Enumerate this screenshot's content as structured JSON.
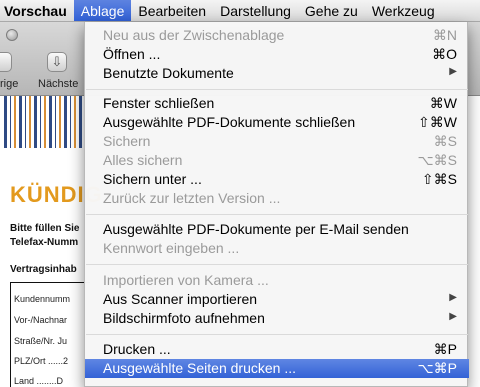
{
  "menubar": {
    "items": [
      "Vorschau",
      "Ablage",
      "Bearbeiten",
      "Darstellung",
      "Gehe zu",
      "Werkzeug"
    ]
  },
  "window": {
    "toolbar_prev_label": "rige",
    "toolbar_next_label": "Nächste"
  },
  "document": {
    "heading": "KÜNDIG",
    "intro_line1": "Bitte füllen Sie",
    "intro_line2": "Telefax-Numm",
    "section": "Vertragsinhab",
    "fields": [
      "Kundennumm",
      "Vor-/Nachnar",
      "Straße/Nr.",
      "PLZ/Ort ......2",
      "Land ........D"
    ],
    "field_values": [
      "",
      "",
      "Ju",
      "",
      ""
    ]
  },
  "menu": {
    "title": "Ablage",
    "items": [
      {
        "label": "Neu aus der Zwischenablage",
        "shortcut": "⌘N",
        "disabled": true
      },
      {
        "label": "Öffnen ...",
        "shortcut": "⌘O",
        "disabled": false
      },
      {
        "label": "Benutzte Dokumente",
        "shortcut": "▶",
        "disabled": false
      },
      {
        "label": "Fenster schließen",
        "shortcut": "⌘W",
        "disabled": false
      },
      {
        "label": "Ausgewählte PDF-Dokumente schließen",
        "shortcut": "⇧⌘W",
        "disabled": false
      },
      {
        "label": "Sichern",
        "shortcut": "⌘S",
        "disabled": true
      },
      {
        "label": "Alles sichern",
        "shortcut": "⌥⌘S",
        "disabled": true
      },
      {
        "label": "Sichern unter ...",
        "shortcut": "⇧⌘S",
        "disabled": false
      },
      {
        "label": "Zurück zur letzten Version ...",
        "shortcut": "",
        "disabled": true
      },
      {
        "label": "Ausgewählte PDF-Dokumente per E-Mail senden",
        "shortcut": "",
        "disabled": false
      },
      {
        "label": "Kennwort eingeben ...",
        "shortcut": "",
        "disabled": true
      },
      {
        "label": "Importieren von Kamera ...",
        "shortcut": "",
        "disabled": true
      },
      {
        "label": "Aus Scanner importieren",
        "shortcut": "▶",
        "disabled": false
      },
      {
        "label": "Bildschirmfoto aufnehmen",
        "shortcut": "▶",
        "disabled": false
      },
      {
        "label": "Drucken ...",
        "shortcut": "⌘P",
        "disabled": false
      },
      {
        "label": "Ausgewählte Seiten drucken ...",
        "shortcut": "⌥⌘P",
        "disabled": false,
        "selected": true
      }
    ]
  }
}
